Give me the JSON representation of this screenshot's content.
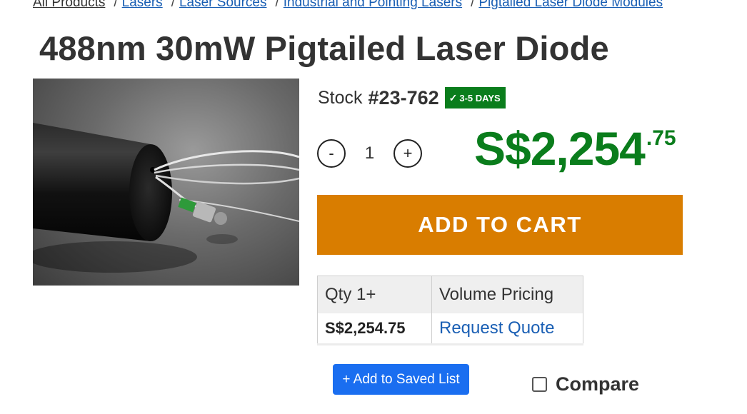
{
  "breadcrumb": [
    {
      "label": "All Products"
    },
    {
      "label": "Lasers"
    },
    {
      "label": "Laser Sources"
    },
    {
      "label": "Industrial and Pointing Lasers"
    },
    {
      "label": "Pigtailed Laser Diode Modules"
    }
  ],
  "breadcrumb_separator": "/",
  "product": {
    "title": "488nm 30mW Pigtailed Laser Diode",
    "stock_label": "Stock",
    "stock_number": "#23-762",
    "badge_icon": "check-icon",
    "badge_check": "✓",
    "availability_badge": "3-5 DAYS"
  },
  "quantity": {
    "decrement_label": "-",
    "value": "1",
    "increment_label": "+"
  },
  "price": {
    "main": "S$2,254",
    "cents": ".75"
  },
  "cart": {
    "add_label": "ADD TO CART"
  },
  "pricing_table": {
    "headers": [
      "Qty 1+",
      "Volume Pricing"
    ],
    "rows": [
      {
        "price": "S$2,254.75",
        "action": "Request Quote"
      }
    ]
  },
  "saved_list": {
    "label": "+ Add to Saved List"
  },
  "compare": {
    "label": "Compare",
    "checked": false
  },
  "colors": {
    "accent_green": "#0a7d1c",
    "cart_orange": "#d97d00",
    "link_blue": "#1a5fb4",
    "button_blue": "#1a6ef0"
  }
}
